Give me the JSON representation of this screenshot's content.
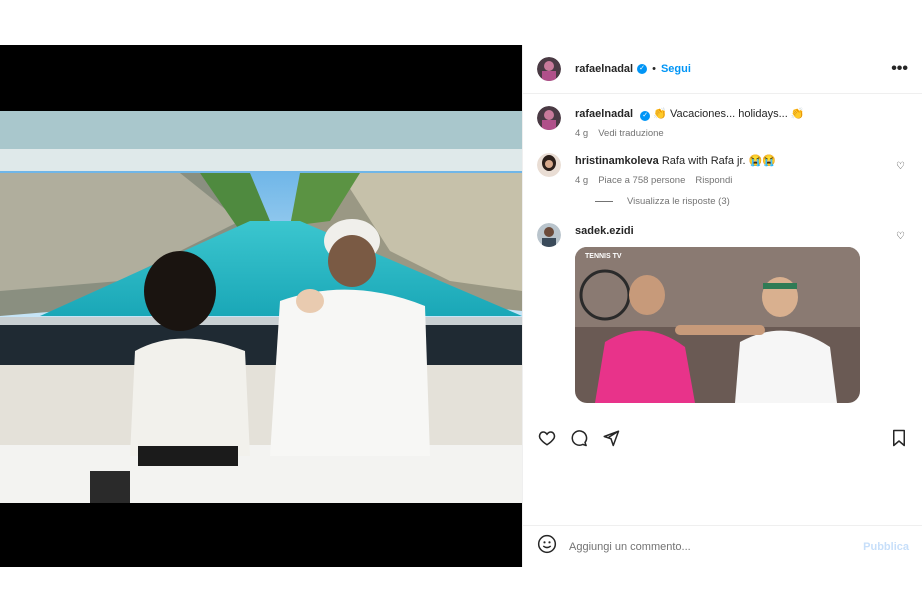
{
  "header": {
    "username": "rafaelnadal",
    "separator": "•",
    "follow_label": "Segui",
    "more_label": "•••"
  },
  "caption": {
    "username": "rafaelnadal",
    "text": "👏 Vacaciones... holidays... 👏",
    "age": "4 g",
    "translate": "Vedi traduzione"
  },
  "comments": [
    {
      "username": "hristinamkoleva",
      "text": "Rafa with Rafa jr. 😭😭",
      "age": "4 g",
      "likes": "Piace a 758 persone",
      "reply": "Rispondi"
    },
    {
      "username": "sadek.ezidi",
      "gif_overlay": "TENNIS TV"
    }
  ],
  "view_replies": "Visualizza le risposte (3)",
  "add_comment": {
    "placeholder": "Aggiungi un commento...",
    "publish": "Pubblica"
  },
  "colors": {
    "accent": "#0095f6",
    "muted": "#737373",
    "publish_disabled": "#c7dffa"
  }
}
